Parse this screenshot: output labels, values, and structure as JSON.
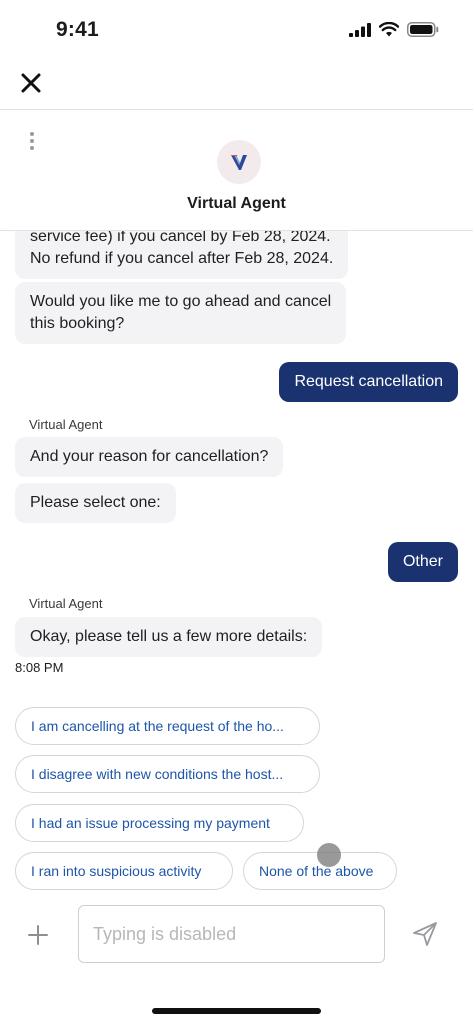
{
  "status_bar": {
    "time": "9:41"
  },
  "header": {
    "agent_name": "Virtual Agent"
  },
  "messages": {
    "m1_line1": "service fee) if you cancel by Feb 28, 2024.",
    "m1_line2": "No refund if you cancel after Feb 28, 2024.",
    "m2_line1": "Would you like me to go ahead and cancel",
    "m2_line2": "this booking?",
    "user1": "Request cancellation",
    "sender1": "Virtual Agent",
    "m3": "And your reason for cancellation?",
    "m4": "Please select one:",
    "user2": "Other",
    "sender2": "Virtual Agent",
    "m5": "Okay, please tell us a few more details:",
    "timestamp": "8:08 PM"
  },
  "quick_replies": [
    "I am cancelling at the request of the ho...",
    "I disagree with new conditions the host...",
    "I had an issue processing my payment",
    "I ran into suspicious activity",
    "None of the above"
  ],
  "composer": {
    "placeholder": "Typing is disabled"
  },
  "colors": {
    "accent": "#1b3270",
    "chip_text": "#1d56a8",
    "bubble_in": "#f3f3f6"
  }
}
